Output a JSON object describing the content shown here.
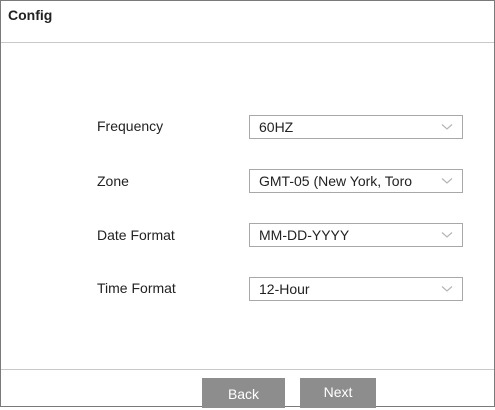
{
  "dialog": {
    "title": "Config"
  },
  "fields": [
    {
      "label": "Frequency",
      "value": "60HZ"
    },
    {
      "label": "Zone",
      "value": "GMT-05 (New York, Toro"
    },
    {
      "label": "Date Format",
      "value": "MM-DD-YYYY"
    },
    {
      "label": "Time Format",
      "value": "12-Hour"
    }
  ],
  "buttons": {
    "back_label": "Back",
    "next_label": "Next"
  },
  "icons": {
    "dropdown": "chevron-down-icon"
  },
  "colors": {
    "button_bg": "#8d8d8d",
    "border": "#a8a8a8"
  }
}
